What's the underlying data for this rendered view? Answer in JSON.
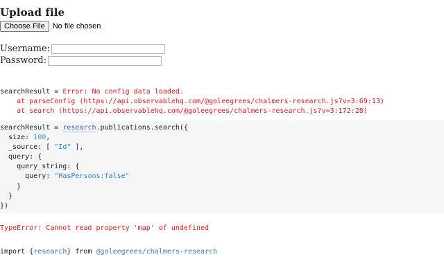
{
  "heading": "Upload file",
  "file_input": {
    "button_label": "Choose File",
    "status": "No file chosen"
  },
  "form": {
    "username_label": "Username:",
    "username_value": "",
    "password_label": "Password:",
    "password_value": ""
  },
  "error_output": {
    "lhs": "searchResult = ",
    "message": "Error: No config data loaded.",
    "stack": [
      "    at parseConfig (https://api.observablehq.com/@goleegrees/chalmers-research.js?v=3:69:13)",
      "    at search (https://api.observablehq.com/@goleegrees/chalmers-research.js?v=3:172:28)"
    ]
  },
  "editor": {
    "line1_prefix": "searchResult = ",
    "line1_ident": "research",
    "line1_suffix": ".publications.search({",
    "line2_key": "  size: ",
    "line2_num": "100",
    "line2_end": ",",
    "line3_key": "  _source: [ ",
    "line3_str": "\"Id\"",
    "line3_end": " ],",
    "line4": "  query: {",
    "line5": "    query_string: {",
    "line6_key": "      query: ",
    "line6_str": "\"HasPersons:false\"",
    "line7": "    }",
    "line8": "  }",
    "line9": "})"
  },
  "type_error": "TypeError: Cannot read property 'map' of undefined",
  "import_cell": {
    "kw_import": "import {",
    "ident": "research",
    "from": "} from ",
    "module": "@goleegrees/chalmers-research"
  },
  "colors": {
    "error": "#e3171b",
    "editor_bg": "#f5f5f5",
    "link": "#3b5fc0",
    "number": "#3b9ad9",
    "string": "#2a7fbf"
  }
}
